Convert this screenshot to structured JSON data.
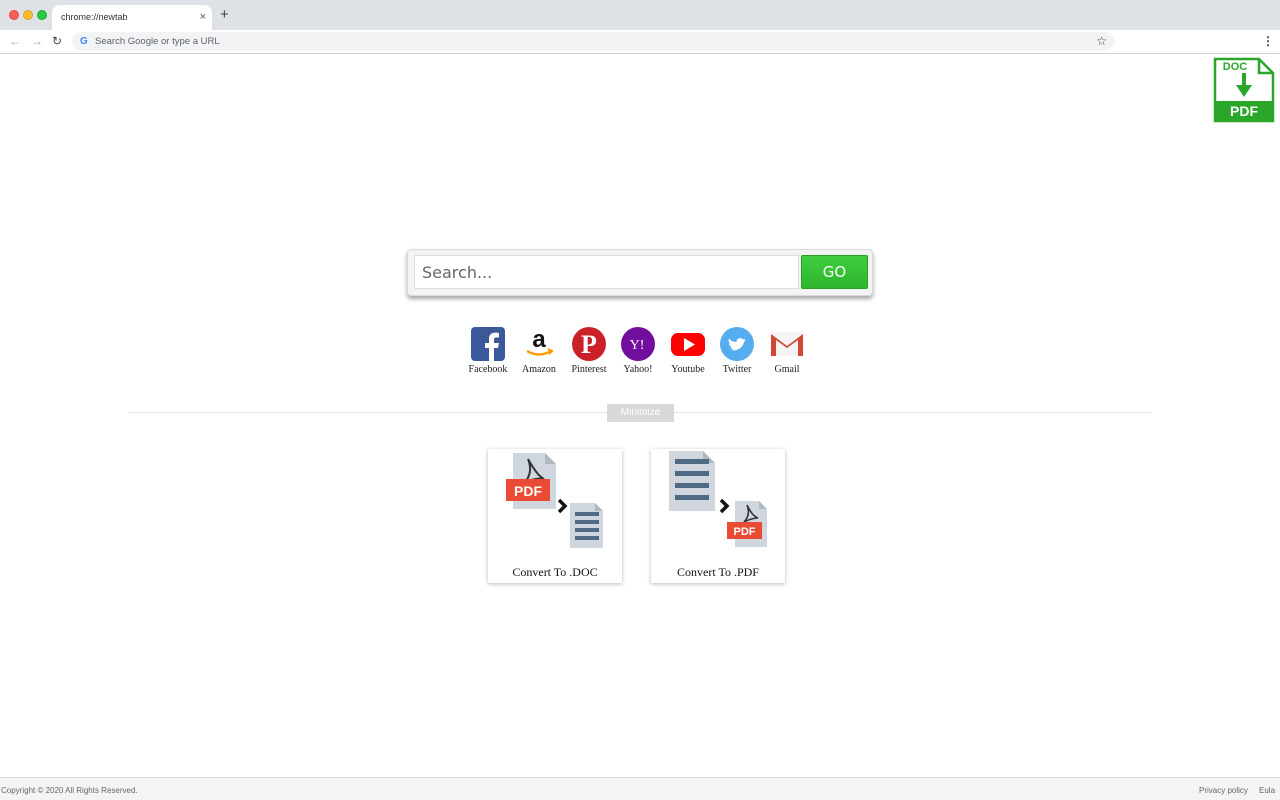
{
  "browser": {
    "tab_title": "chrome://newtab",
    "tab_close": "×",
    "new_tab": "+",
    "back": "←",
    "forward": "→",
    "reload": "↻",
    "google_g": "G",
    "omnibox_placeholder": "Search Google or type a URL",
    "star": "☆",
    "menu": "⋮"
  },
  "extension_logo": {
    "top_text": "DOC",
    "bottom_text": "PDF",
    "color": "#2aa72a"
  },
  "search": {
    "placeholder": "Search...",
    "go_label": "GO",
    "go_color": "#36c036"
  },
  "shortcuts": [
    {
      "label": "Facebook",
      "icon": "facebook-icon",
      "color": "#3b5998"
    },
    {
      "label": "Amazon",
      "icon": "amazon-icon",
      "color": "#000000"
    },
    {
      "label": "Pinterest",
      "icon": "pinterest-icon",
      "color": "#cb2027"
    },
    {
      "label": "Yahoo!",
      "icon": "yahoo-icon",
      "color": "#720e9e"
    },
    {
      "label": "Youtube",
      "icon": "youtube-icon",
      "color": "#ff0000"
    },
    {
      "label": "Twitter",
      "icon": "twitter-icon",
      "color": "#55acee"
    },
    {
      "label": "Gmail",
      "icon": "gmail-icon",
      "color": "#d14836"
    }
  ],
  "minimize_label": "Minimize",
  "converters": [
    {
      "label": "Convert To .DOC",
      "badge": "PDF"
    },
    {
      "label": "Convert To .PDF",
      "badge": "PDF"
    }
  ],
  "footer": {
    "copyright": "Copyright © 2020 All Rights Reserved.",
    "privacy": "Privacy policy",
    "eula": "Eula"
  }
}
